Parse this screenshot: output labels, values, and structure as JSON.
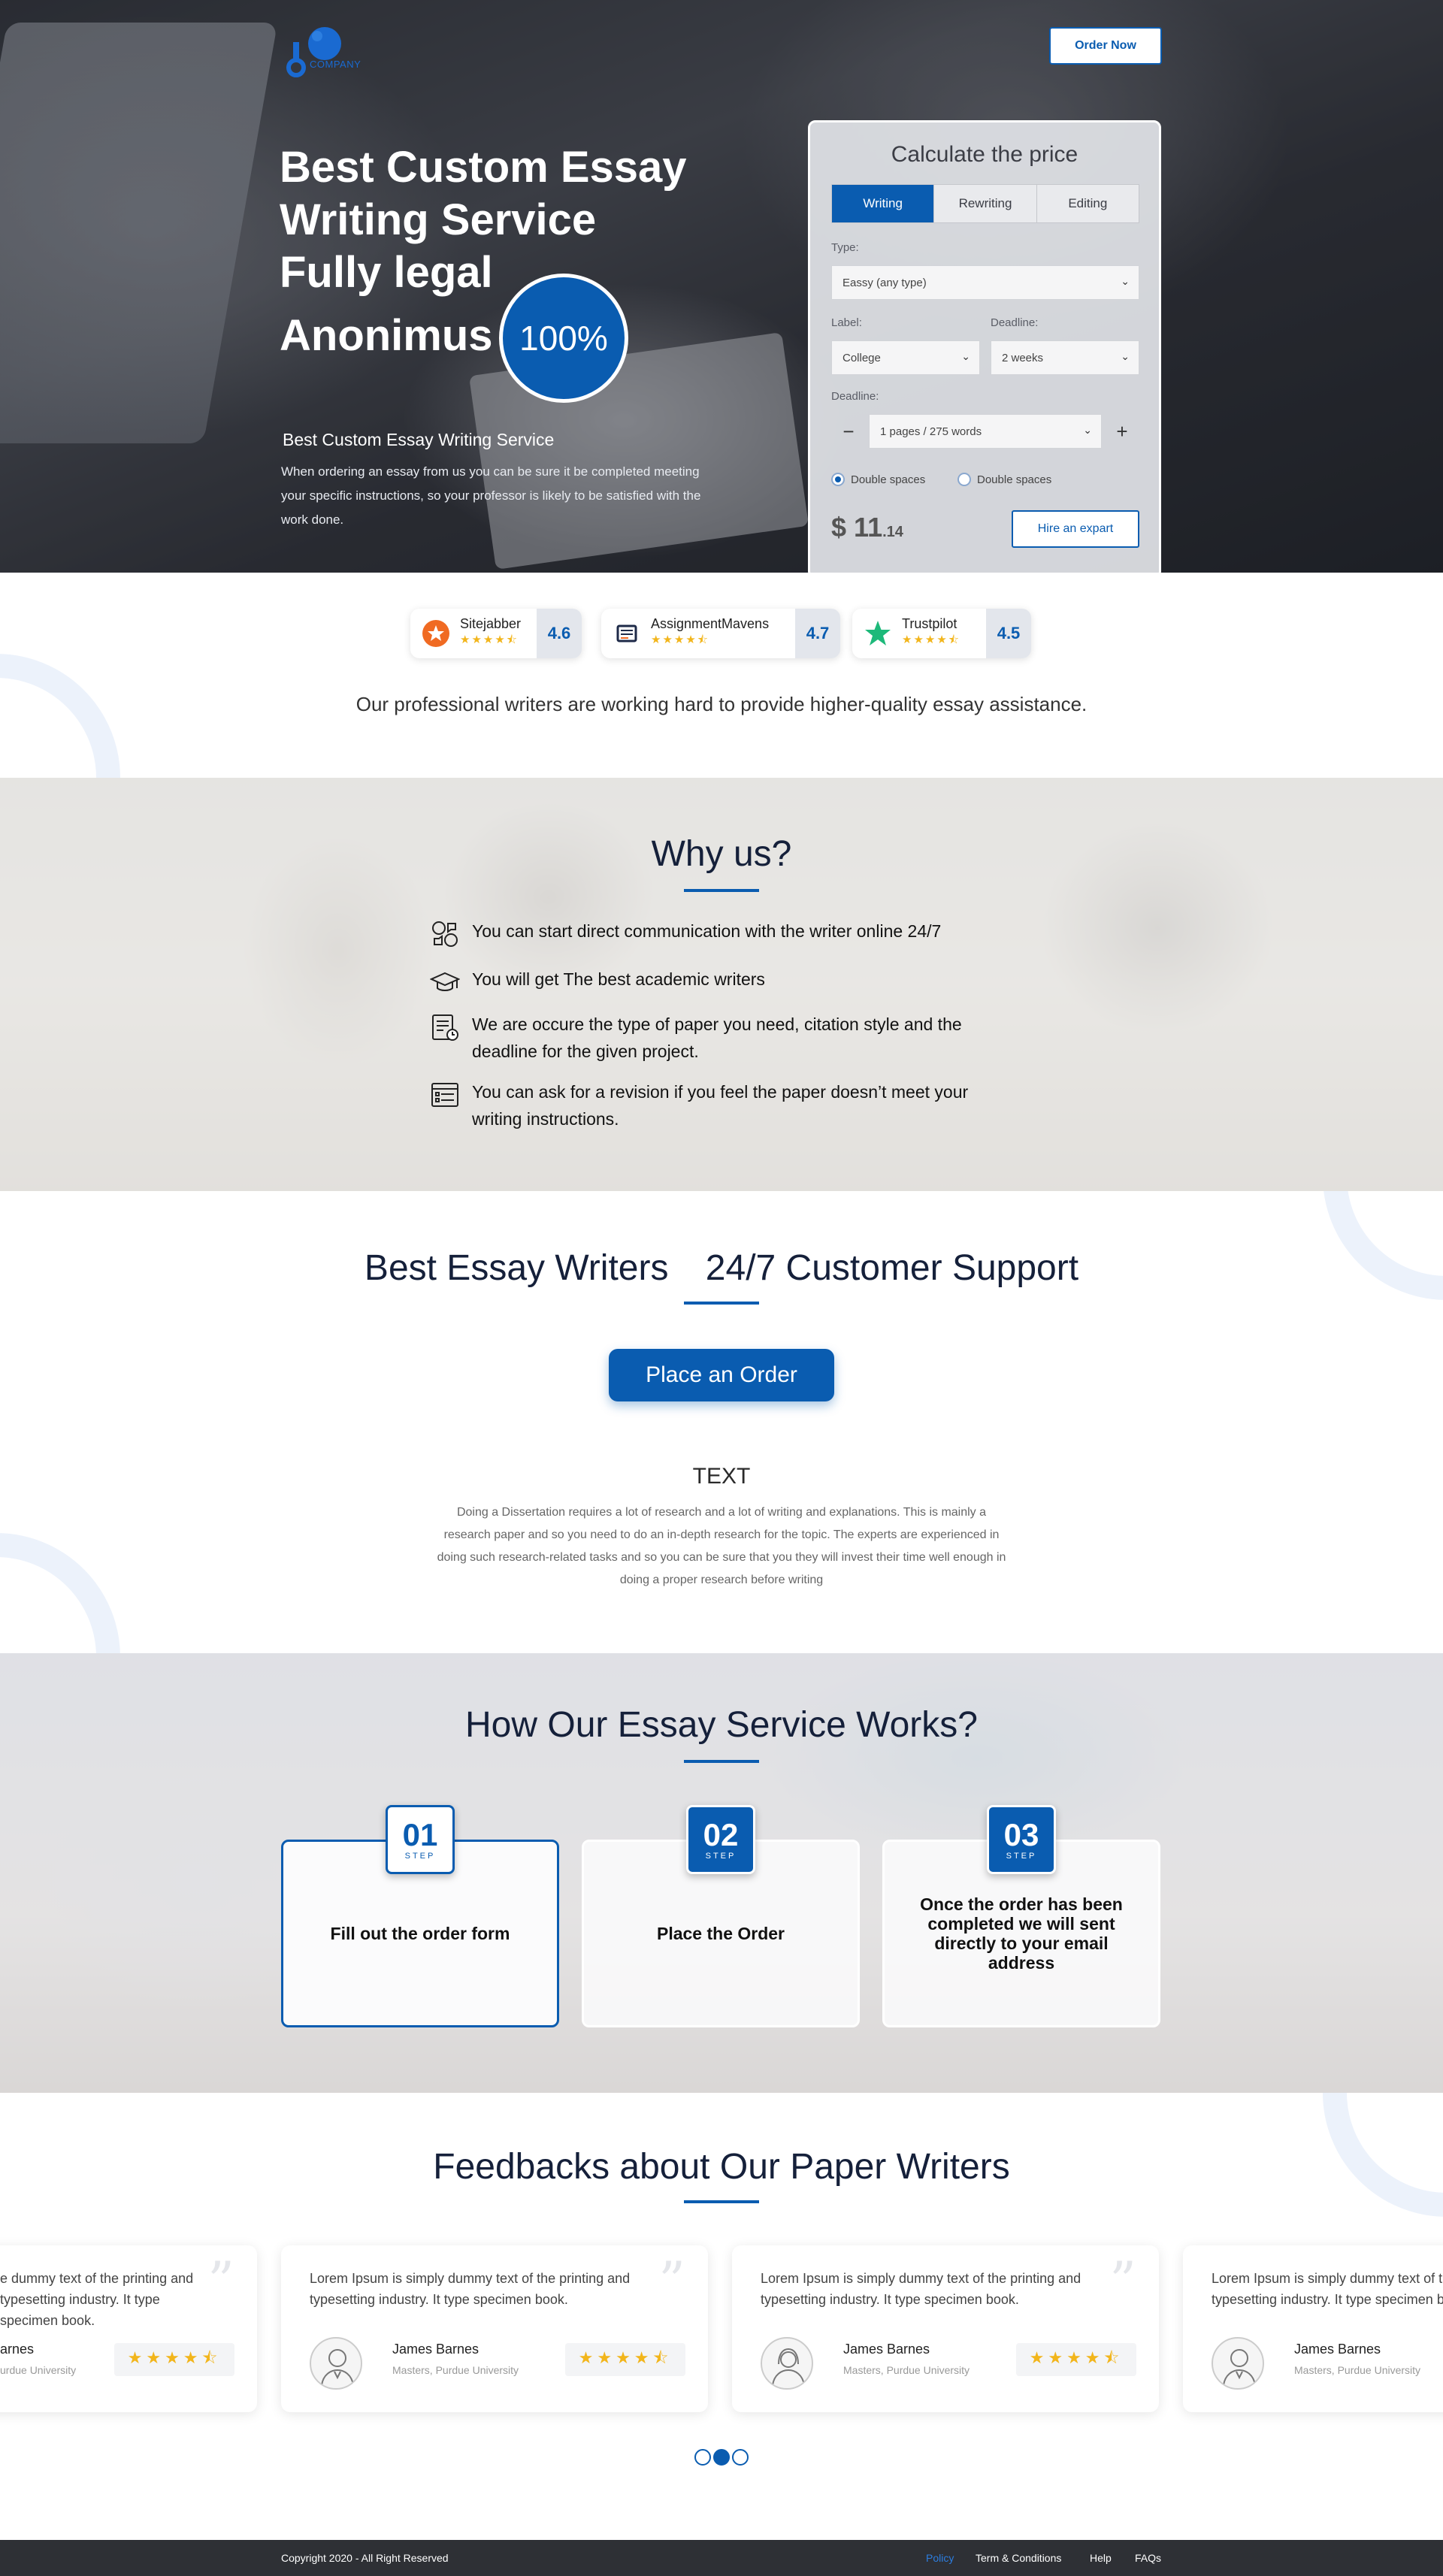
{
  "brand": {
    "logo_text": "COMPANY"
  },
  "header": {
    "order_now": "Order Now"
  },
  "hero": {
    "title_line1": "Best Custom Essay",
    "title_line2": "Writing Service",
    "title_line3": "Fully legal",
    "title_line4": "Anonimus",
    "badge": "100%",
    "subtitle": "Best Custom Essay Writing Service",
    "description": "When ordering an essay from us you can be sure it be completed meeting your specific instructions, so your professor is likely to be satisfied with the work done."
  },
  "calculator": {
    "title": "Calculate the price",
    "tabs": [
      "Writing",
      "Rewriting",
      "Editing"
    ],
    "active_tab": "Writing",
    "type_label": "Type:",
    "type_value": "Eassy (any type)",
    "level_label": "Label:",
    "level_value": "College",
    "deadline_label": "Deadline:",
    "deadline_value": "2 weeks",
    "pages_label": "Deadline:",
    "pages_value": "1 pages / 275 words",
    "minus": "−",
    "plus": "+",
    "spacing_1": "Double spaces",
    "spacing_2": "Double spaces",
    "price_currency": "$",
    "price_main": "11",
    "price_cents": ".14",
    "hire": "Hire an expart",
    "accent": "#0a5cb0"
  },
  "ratings": [
    {
      "name": "Sitejabber",
      "score": "4.6",
      "stars": "★★★★⯪",
      "icon": "sitejabber-icon"
    },
    {
      "name": "AssignmentMavens",
      "score": "4.7",
      "stars": "★★★★⯪",
      "icon": "assignmentmavens-icon"
    },
    {
      "name": "Trustpilot",
      "score": "4.5",
      "stars": "★★★★⯪",
      "icon": "trustpilot-icon"
    }
  ],
  "tagline": "Our professional writers are working hard to provide higher-quality essay assistance.",
  "why": {
    "title": "Why us?",
    "items": [
      {
        "text": "You can start direct communication with the writer online 24/7",
        "icon": "chat-users-icon"
      },
      {
        "text": "You will get The best academic writers",
        "icon": "graduation-cap-icon"
      },
      {
        "text": "We are occure the type of paper you need, citation style and the deadline for the given project.",
        "icon": "document-clock-icon"
      },
      {
        "text": "You can ask for a revision if you feel the paper doesn’t meet your writing instructions.",
        "icon": "list-document-icon"
      }
    ]
  },
  "writers": {
    "title_left": "Best Essay Writers",
    "title_right": "24/7 Customer Support",
    "cta": "Place an Order",
    "text_title": "TEXT",
    "text_body": "Doing a Dissertation requires a lot of research and a lot of writing and explanations. This is mainly a research paper and so you need to do an in-depth research for the topic. The experts are experienced in doing such research-related tasks and so you can be sure that you they will invest their time well enough in doing a proper research before writing"
  },
  "how": {
    "title": "How Our Essay Service Works?",
    "steps": [
      {
        "num": "01",
        "label": "STEP",
        "text": "Fill out the order form"
      },
      {
        "num": "02",
        "label": "STEP",
        "text": "Place the Order"
      },
      {
        "num": "03",
        "label": "STEP",
        "text": "Once the order has been completed we will sent directly to your email address"
      }
    ]
  },
  "feedback": {
    "title": "Feedbacks about Our Paper Writers",
    "cards": [
      {
        "text": "e dummy text of the printing and  typesetting industry.  It type specimen book.",
        "name": "arnes",
        "role": "urdue University",
        "stars": "★★★★⯪"
      },
      {
        "text": "Lorem Ipsum is simply dummy text of the printing and typesetting industry.  It type specimen book.",
        "name": "James Barnes",
        "role": "Masters, Purdue University",
        "stars": "★★★★⯪"
      },
      {
        "text": "Lorem Ipsum is simply dummy text of the printing and typesetting industry.  It type specimen book.",
        "name": "James Barnes",
        "role": "Masters, Purdue University",
        "stars": "★★★★⯪"
      },
      {
        "text": "Lorem Ipsum is simply dummy text of the printing and typesetting industry.  It type specimen book.",
        "name": "James Barnes",
        "role": "Masters, Purdue University",
        "stars": "★★★★⯪"
      }
    ],
    "active_dot": 2
  },
  "footer": {
    "copyright": "Copyright 2020 - All Right Reserved",
    "links": [
      "Policy",
      "Term & Conditions",
      "Help",
      "FAQs"
    ],
    "active_link": "Policy"
  }
}
